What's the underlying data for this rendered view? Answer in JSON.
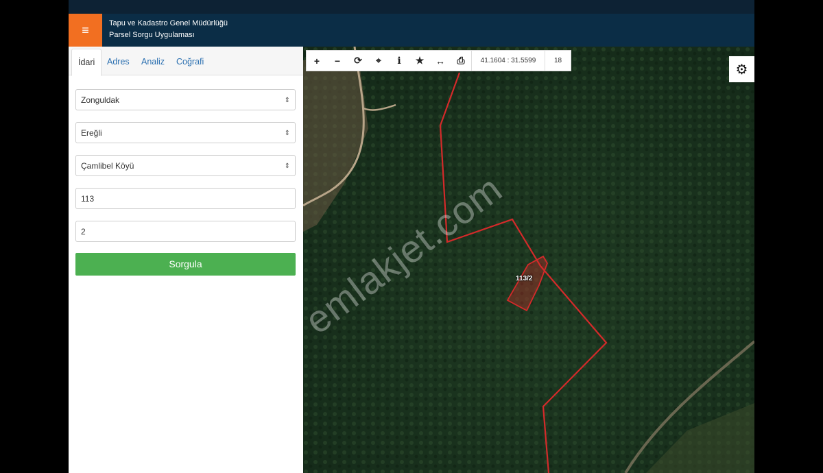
{
  "header": {
    "menu_icon": "≡",
    "title_line1": "Tapu ve Kadastro Genel Müdürlüğü",
    "title_line2": "Parsel Sorgu Uygulaması"
  },
  "tabs": [
    {
      "label": "İdari",
      "active": true
    },
    {
      "label": "Adres"
    },
    {
      "label": "Analiz"
    },
    {
      "label": "Coğrafi"
    }
  ],
  "form": {
    "province": "Zonguldak",
    "district": "Ereğli",
    "neighborhood": "Çamlibel Köyü",
    "block": "113",
    "parcel": "2",
    "submit_label": "Sorgula"
  },
  "toolbar": {
    "icons": [
      "plus-icon",
      "minus-icon",
      "refresh-icon",
      "locate-icon",
      "info-icon",
      "star-icon",
      "measure-icon",
      "print-icon"
    ],
    "coordinates": "41.1604 : 31.5599",
    "zoom_level": "18"
  },
  "map": {
    "parcel_label": "113/2",
    "watermark": "emlakjet.com",
    "boundary_color": "#d42a2a"
  }
}
